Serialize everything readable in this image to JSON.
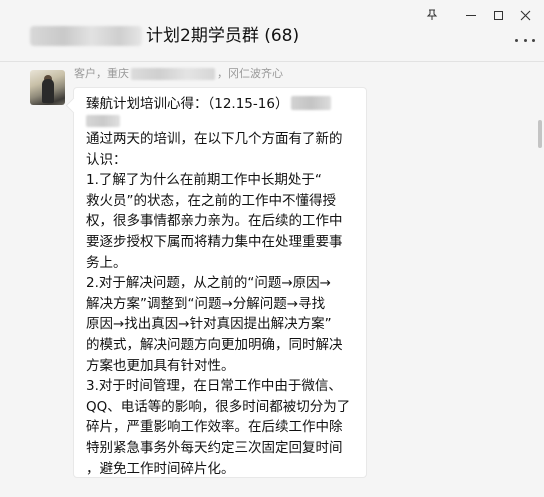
{
  "window": {
    "title": "计划2期学员群 (68)",
    "controls": {
      "pin": "pin-icon",
      "minimize": "minimize-icon",
      "maximize": "maximize-icon",
      "close": "close-icon"
    }
  },
  "message": {
    "sender_prefix": "客户，重庆",
    "sender_suffix": "，冈仁波齐心",
    "heading": "臻航计划培训心得：（12.15-16）",
    "lines": [
      "通过两天的培训，在以下几个方面有了新的",
      "认识：",
      "1.了解了为什么在前期工作中长期处于“",
      "救火员”的状态，在之前的工作中不懂得授",
      "权，很多事情都亲力亲为。在后续的工作中",
      "要逐步授权下属而将精力集中在处理重要事",
      "务上。",
      "2.对于解决问题，从之前的“问题→原因→",
      "解决方案”调整到“问题→分解问题→寻找",
      "原因→找出真因→针对真因提出解决方案”",
      "的模式，解决问题方向更加明确，同时解决",
      "方案也更加具有针对性。",
      "3.对于时间管理，在日常工作中由于微信、",
      "QQ、电话等的影响，很多时间都被切分为了",
      "碎片，严重影响工作效率。在后续工作中除",
      "特别紧急事务外每天约定三次固定回复时间",
      "，避免工作时间碎片化。"
    ]
  }
}
